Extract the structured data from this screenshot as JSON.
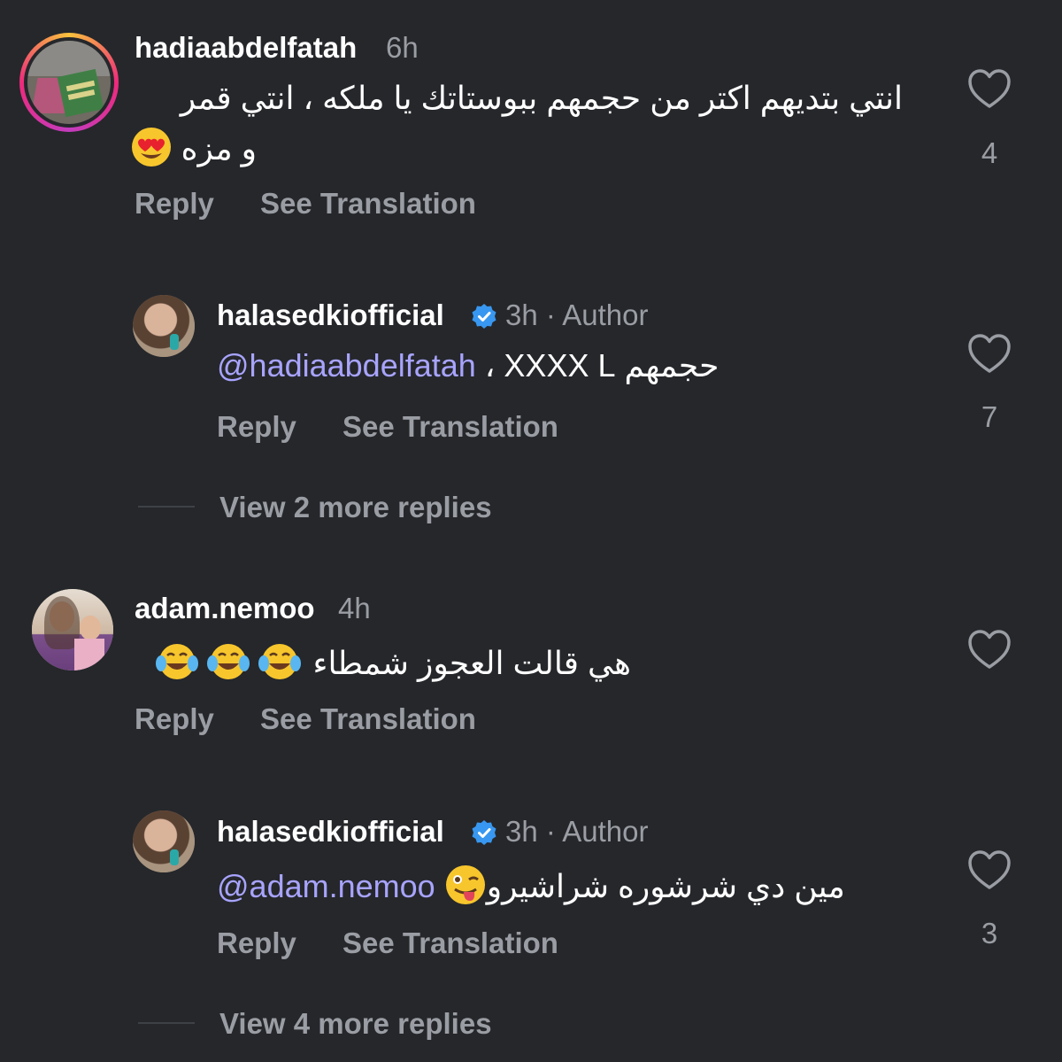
{
  "comments": [
    {
      "username": "hadiaabdelfatah",
      "time": "6h",
      "text_line1": "انتي بتديهم اكتر من حجمهم ببوستاتك يا ملكه ، انتي قمر",
      "text_line2": "و مزه",
      "emoji": "heart-eyes",
      "likes": "4",
      "reply_label": "Reply",
      "translate_label": "See Translation"
    },
    {
      "username": "adam.nemoo",
      "time": "4h",
      "text": "هي قالت العجوز شمطاء",
      "emoji": "tears-of-joy",
      "reply_label": "Reply",
      "translate_label": "See Translation"
    }
  ],
  "replies": [
    {
      "username": "halasedkiofficial",
      "time": "3h",
      "separator": "·",
      "author_label": "Author",
      "mention": "@hadiaabdelfatah",
      "text": "حجمهم XXXX L ،",
      "likes": "7",
      "reply_label": "Reply",
      "translate_label": "See Translation",
      "view_more": "View 2 more replies"
    },
    {
      "username": "halasedkiofficial",
      "time": "3h",
      "separator": "·",
      "author_label": "Author",
      "mention": "@adam.nemoo",
      "text": "مين دي شرشوره شراشيرو",
      "emoji": "winking-tongue",
      "likes": "3",
      "reply_label": "Reply",
      "translate_label": "See Translation",
      "view_more": "View 4 more replies"
    }
  ],
  "colors": {
    "background": "#25272b",
    "mention": "#a8a4ff",
    "muted": "#9a9da3",
    "verified": "#3897f0"
  }
}
